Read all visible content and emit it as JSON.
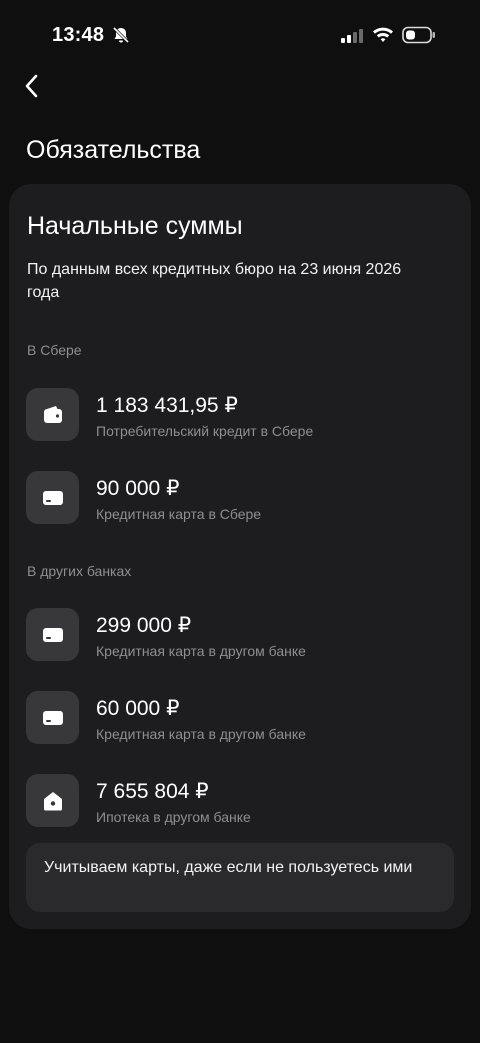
{
  "status_bar": {
    "time": "13:48"
  },
  "header": {
    "title": "Обязательства"
  },
  "card": {
    "title": "Начальные суммы",
    "subtitle": "По данным всех кредитных бюро на 23 июня 2026 года",
    "sections": [
      {
        "label": "В Сбере",
        "items": [
          {
            "icon": "wallet-icon",
            "amount": "1 183 431,95 ₽",
            "description": "Потребительский кредит в Сбере"
          },
          {
            "icon": "card-icon",
            "amount": "90 000 ₽",
            "description": "Кредитная карта в Сбере"
          }
        ]
      },
      {
        "label": "В других банках",
        "items": [
          {
            "icon": "card-icon",
            "amount": "299 000 ₽",
            "description": "Кредитная карта в другом банке"
          },
          {
            "icon": "card-icon",
            "amount": "60 000 ₽",
            "description": "Кредитная карта в другом банке"
          },
          {
            "icon": "house-icon",
            "amount": "7 655 804 ₽",
            "description": "Ипотека в другом банке"
          }
        ]
      }
    ],
    "note": "Учитываем карты, даже если не пользуетесь ими"
  }
}
